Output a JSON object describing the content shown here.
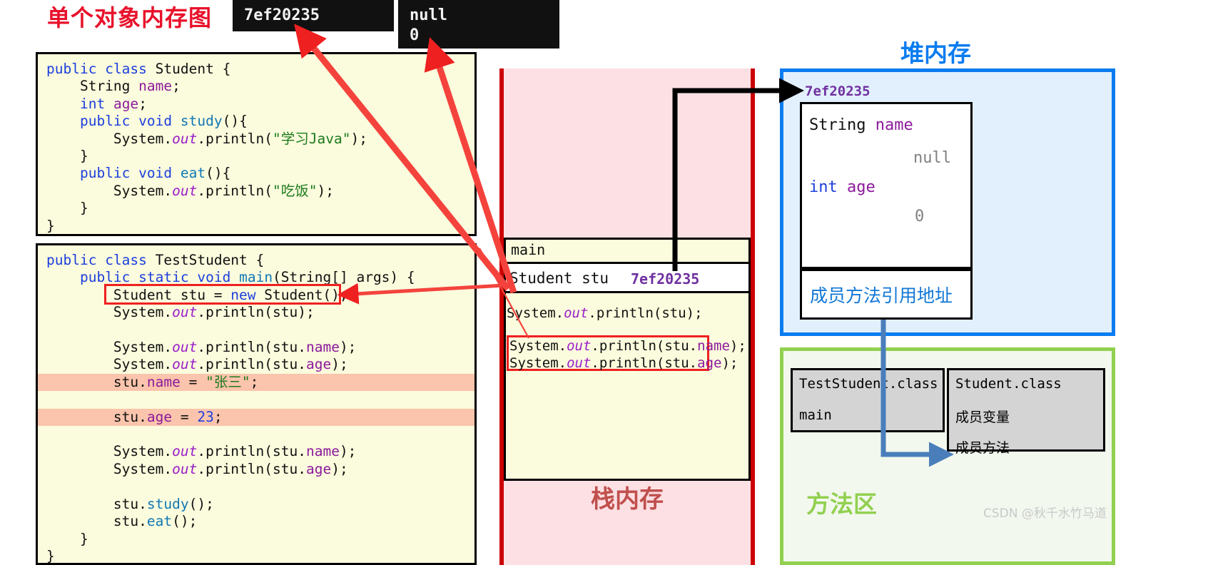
{
  "title": "单个对象内存图",
  "console": {
    "box1": "7ef20235",
    "box2_line1": "null",
    "box2_line2": "0"
  },
  "code_student": {
    "lines": [
      "public class Student {",
      "    String name;",
      "    int age;",
      "    public void study(){",
      "        System.out.println(\"学习Java\");",
      "    }",
      "    public void eat(){",
      "        System.out.println(\"吃饭\");",
      "    }",
      "}"
    ]
  },
  "code_test": {
    "lines": [
      "public class TestStudent {",
      "    public static void main(String[] args) {",
      "        Student stu = new Student();",
      "        System.out.println(stu);",
      "",
      "        System.out.println(stu.name);",
      "        System.out.println(stu.age);",
      "        stu.name = \"张三\";",
      "        stu.age = 23;",
      "        System.out.println(stu.name);",
      "        System.out.println(stu.age);",
      "",
      "        stu.study();",
      "        stu.eat();",
      "    }",
      "}"
    ],
    "highlighted_lines": [
      "stu.name = \"张三\";",
      "stu.age = 23;"
    ],
    "boxed_line": "Student stu = new Student();"
  },
  "stack": {
    "label": "栈内存",
    "frame_title": "main",
    "var_name": "Student stu",
    "var_value": "7ef20235",
    "line1": "System.out.println(stu);",
    "boxed_line1": "System.out.println(stu.name);",
    "boxed_line2": "System.out.println(stu.age);"
  },
  "heap": {
    "label": "堆内存",
    "address": "7ef20235",
    "field1_type": "String",
    "field1_name": "name",
    "field1_value": "null",
    "field2_type": "int",
    "field2_name": "age",
    "field2_value": "0",
    "methods_ref": "成员方法引用地址"
  },
  "method_area": {
    "label": "方法区",
    "class1_name": "TestStudent.class",
    "class1_member": "main",
    "class2_name": "Student.class",
    "class2_member1": "成员变量",
    "class2_member2": "成员方法"
  },
  "watermark": "CSDN @秋千水竹马道",
  "colors": {
    "title_red": "#e8122b",
    "stack_red": "#cc0000",
    "heap_blue": "#0a7cf0",
    "method_green": "#92d050",
    "arrow_red": "#ef2020",
    "arrow_blue": "#4a7ebb",
    "highlight": "#fbc4ac",
    "code_bg": "#fbfbdd"
  }
}
